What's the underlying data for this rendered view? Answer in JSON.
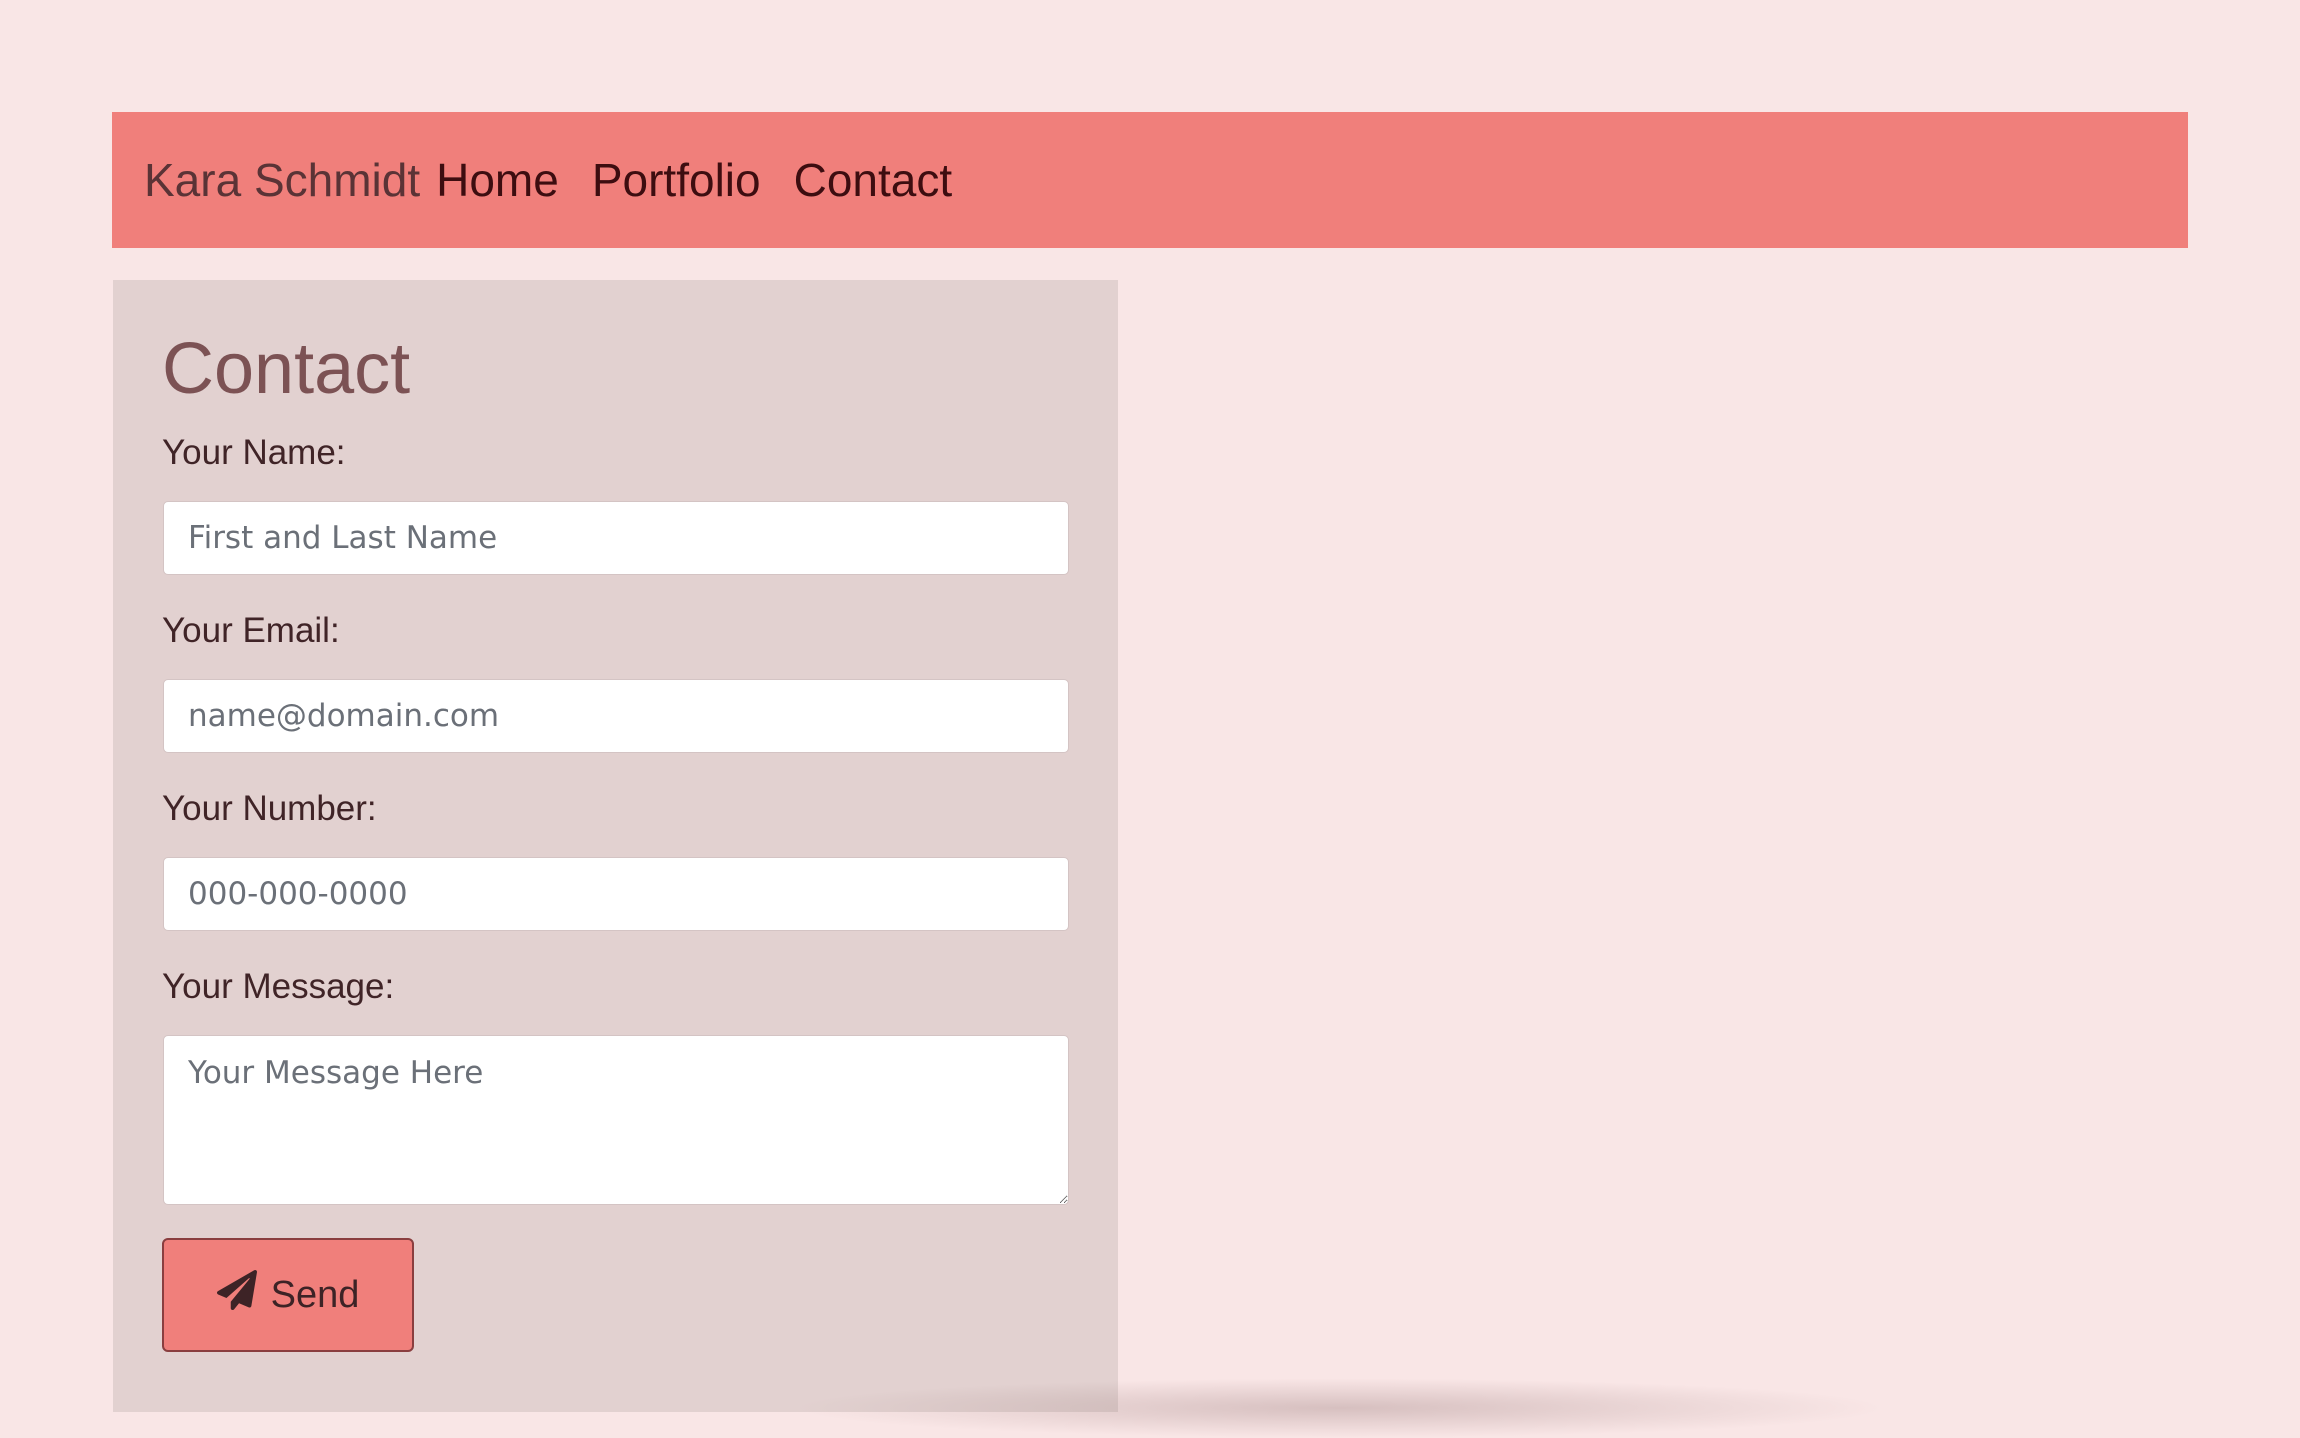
{
  "navbar": {
    "brand": "Kara Schmidt",
    "links": [
      {
        "label": "Home"
      },
      {
        "label": "Portfolio"
      },
      {
        "label": "Contact"
      }
    ]
  },
  "contact": {
    "title": "Contact",
    "fields": {
      "name": {
        "label": "Your Name:",
        "placeholder": "First and Last Name",
        "value": ""
      },
      "email": {
        "label": "Your Email:",
        "placeholder": "name@domain.com",
        "value": ""
      },
      "number": {
        "label": "Your Number:",
        "placeholder": "000-000-0000",
        "value": ""
      },
      "message": {
        "label": "Your Message:",
        "placeholder": "Your Message Here",
        "value": ""
      }
    },
    "send_label": "Send",
    "send_icon": "paper-plane-icon"
  },
  "colors": {
    "page_bg": "#f9e6e6",
    "navbar_bg": "#f07f7b",
    "panel_bg": "#e2d1d0",
    "title_color": "#7c5254",
    "button_bg": "#f07f7b"
  }
}
